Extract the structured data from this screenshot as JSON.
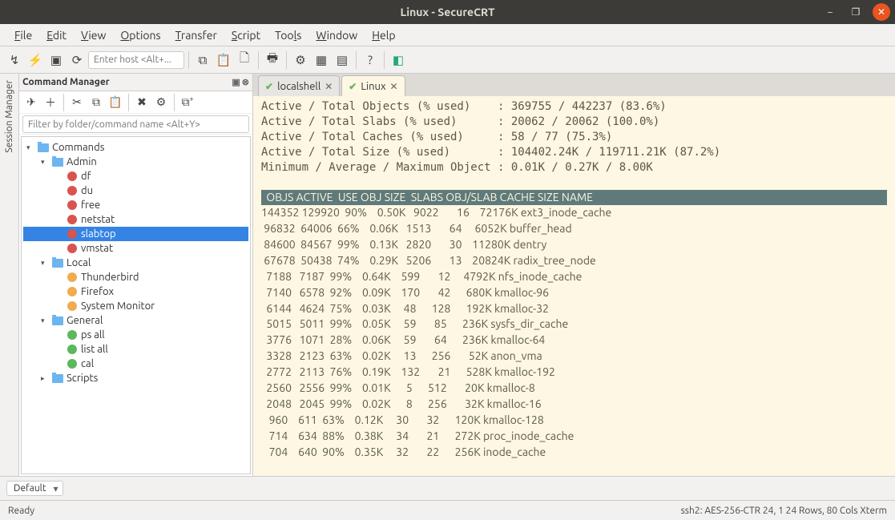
{
  "window": {
    "title": "Linux - SecureCRT"
  },
  "menubar": [
    "File",
    "Edit",
    "View",
    "Options",
    "Transfer",
    "Script",
    "Tools",
    "Window",
    "Help"
  ],
  "toolbar": {
    "host_placeholder": "Enter host <Alt+..."
  },
  "session_tab": "Session Manager",
  "cmd": {
    "title": "Command Manager",
    "filter_placeholder": "Filter by folder/command name <Alt+Y>",
    "tree": {
      "root": "Commands",
      "groups": [
        {
          "name": "Admin",
          "icon": "red",
          "items": [
            "df",
            "du",
            "free",
            "netstat",
            "slabtop",
            "vmstat"
          ],
          "selected": "slabtop"
        },
        {
          "name": "Local",
          "icon": "orange",
          "items": [
            "Thunderbird",
            "Firefox",
            "System Monitor"
          ]
        },
        {
          "name": "General",
          "icon": "green",
          "items": [
            "ps all",
            "list all",
            "cal"
          ]
        }
      ],
      "extra_folder": "Scripts"
    }
  },
  "tabs": [
    {
      "label": "localshell",
      "active": false
    },
    {
      "label": "Linux",
      "active": true
    }
  ],
  "terminal": {
    "summary": [
      "Active / Total Objects (% used)    : 369755 / 442237 (83.6%)",
      "Active / Total Slabs (% used)      : 20062 / 20062 (100.0%)",
      "Active / Total Caches (% used)     : 58 / 77 (75.3%)",
      "Active / Total Size (% used)       : 104402.24K / 119711.21K (87.2%)",
      "Minimum / Average / Maximum Object : 0.01K / 0.27K / 8.00K"
    ],
    "header": "  OBJS ACTIVE  USE OBJ SIZE  SLABS OBJ/SLAB CACHE SIZE NAME                   ",
    "rows": [
      "144352 129920  90%    0.50K   9022       16    72176K ext3_inode_cache",
      " 96832  64006  66%    0.06K   1513       64     6052K buffer_head",
      " 84600  84567  99%    0.13K   2820       30    11280K dentry",
      " 67678  50438  74%    0.29K   5206       13    20824K radix_tree_node",
      "  7188   7187  99%    0.64K    599       12     4792K nfs_inode_cache",
      "  7140   6578  92%    0.09K    170       42      680K kmalloc-96",
      "  6144   4624  75%    0.03K     48      128      192K kmalloc-32",
      "  5015   5011  99%    0.05K     59       85      236K sysfs_dir_cache",
      "  3776   1071  28%    0.06K     59       64      236K kmalloc-64",
      "  3328   2123  63%    0.02K     13      256       52K anon_vma",
      "  2772   2113  76%    0.19K    132       21      528K kmalloc-192",
      "  2560   2556  99%    0.01K      5      512       20K kmalloc-8",
      "  2048   2045  99%    0.02K      8      256       32K kmalloc-16",
      "   960    611  63%    0.12K     30       32      120K kmalloc-128",
      "   714    634  88%    0.38K     34       21      272K proc_inode_cache",
      "   704    640  90%    0.35K     32       22      256K inode_cache"
    ]
  },
  "bottom": {
    "scheme": "Default"
  },
  "status": {
    "left": "Ready",
    "right": "ssh2: AES-256-CTR     24,   1  24 Rows,  80 Cols  Xterm"
  }
}
